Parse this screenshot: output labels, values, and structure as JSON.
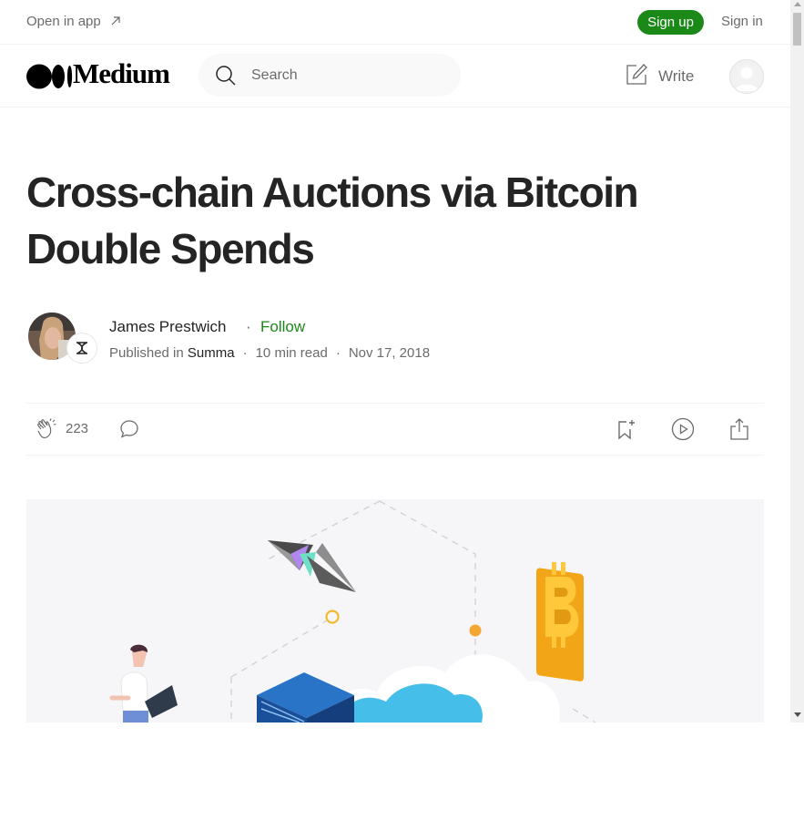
{
  "topbar": {
    "open_in_app": "Open in app",
    "sign_up": "Sign up",
    "sign_in": "Sign in"
  },
  "nav": {
    "logo_text": "Medium",
    "search_placeholder": "Search",
    "write_label": "Write"
  },
  "article": {
    "title": "Cross-chain Auctions via Bitcoin Double Spends",
    "author": "James Prestwich",
    "follow": "Follow",
    "published_in_prefix": "Published in",
    "publication": "Summa",
    "read_time": "10 min read",
    "date": "Nov 17, 2018",
    "claps": "223"
  },
  "colors": {
    "brand_green": "#1a8917",
    "text_primary": "#242424",
    "text_secondary": "#6b6b6b"
  },
  "icons": [
    "arrow-up-right-icon",
    "medium-logo-icon",
    "search-icon",
    "write-icon",
    "avatar",
    "clap-icon",
    "comment-icon",
    "bookmark-icon",
    "listen-icon",
    "share-icon"
  ]
}
